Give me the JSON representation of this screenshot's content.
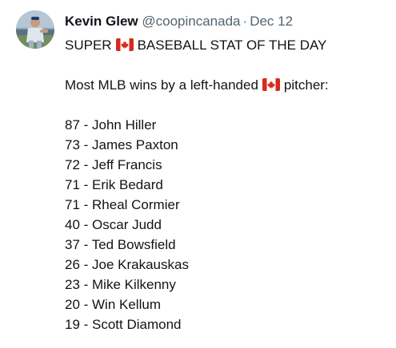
{
  "tweet": {
    "author": {
      "display_name": "Kevin Glew",
      "handle": "@coopincanada",
      "separator": "·",
      "date": "Dec 12",
      "avatar_icon": "profile-photo"
    },
    "headline": {
      "before_flag": "SUPER",
      "flag_icon": "canada-flag-icon",
      "after_flag": "BASEBALL STAT OF THE DAY"
    },
    "intro": {
      "before_flag": "Most MLB wins by a left-handed",
      "flag_icon": "canada-flag-icon",
      "after_flag": "pitcher:"
    },
    "list": [
      "87 - John Hiller",
      "73 - James Paxton",
      "72 - Jeff Francis",
      "71 - Erik Bedard",
      "71 - Rheal Cormier",
      "40 - Oscar Judd",
      "37 - Ted Bowsfield",
      "26 - Joe Krakauskas",
      "23 - Mike Kilkenny",
      "20 - Win Kellum",
      "19 - Scott Diamond"
    ],
    "colors": {
      "text": "#0f1419",
      "secondary": "#536471",
      "flag_red": "#d52b1e"
    }
  }
}
